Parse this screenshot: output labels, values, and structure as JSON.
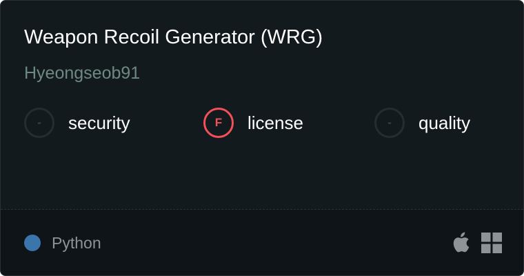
{
  "repo": {
    "title": "Weapon Recoil Generator (WRG)",
    "author": "Hyeongseob91"
  },
  "metrics": [
    {
      "grade": "-",
      "label": "security"
    },
    {
      "grade": "F",
      "label": "license"
    },
    {
      "grade": "-",
      "label": "quality"
    }
  ],
  "footer": {
    "language": "Python",
    "language_color": "#3a75ac",
    "platform_icons": [
      "apple-icon",
      "windows-icon"
    ]
  },
  "colors": {
    "card_background": "#121a1d",
    "grade_f": "#f2505a"
  }
}
